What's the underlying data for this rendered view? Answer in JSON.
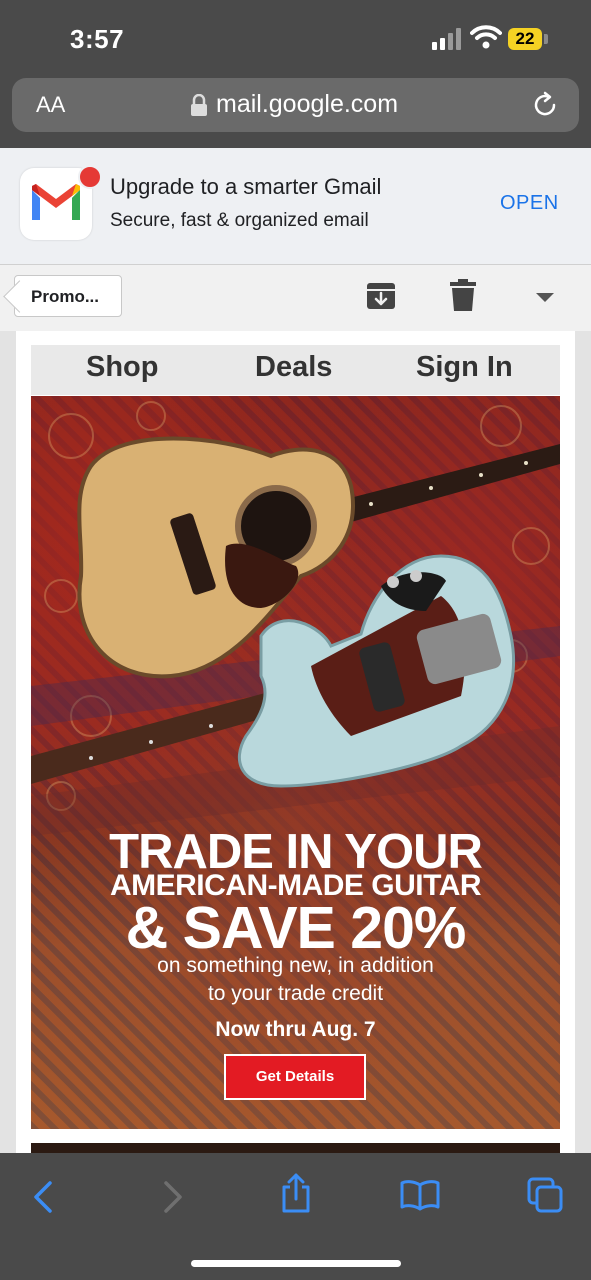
{
  "status": {
    "time": "3:57",
    "battery": "22"
  },
  "browser": {
    "aa_label": "AA",
    "url": "mail.google.com"
  },
  "app_banner": {
    "title": "Upgrade to a smarter Gmail",
    "subtitle": "Secure, fast & organized email",
    "open_label": "OPEN"
  },
  "toolbar": {
    "back_label": "Promo..."
  },
  "email": {
    "nav": [
      "Shop",
      "Deals",
      "Sign In"
    ],
    "headline_line1": "TRADE IN YOUR",
    "headline_line2": "AMERICAN-MADE GUITAR",
    "headline_line3": "& SAVE 20%",
    "subline1": "on something new, in addition",
    "subline2": "to your trade credit",
    "date_text": "Now thru Aug. 7",
    "cta_label": "Get Details"
  },
  "colors": {
    "accent": "#1a73e8",
    "cta": "#e31b23",
    "chrome": "#4a4a4a"
  }
}
